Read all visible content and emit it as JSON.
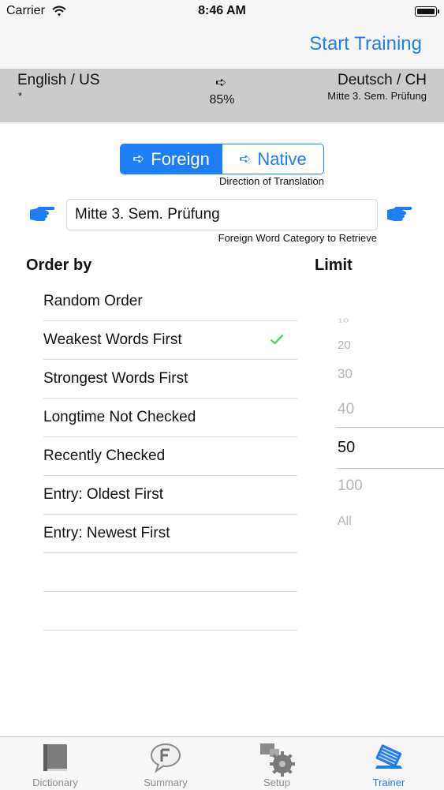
{
  "status_bar": {
    "carrier": "Carrier",
    "time": "8:46 AM"
  },
  "nav": {
    "start_training": "Start Training"
  },
  "language_bar": {
    "left_language": "English / US",
    "left_sub": "*",
    "arrow": "➪",
    "percent": "85%",
    "right_language": "Deutsch / CH",
    "right_sub": "Mitte 3. Sem. Prüfung"
  },
  "direction": {
    "arrow": "➪",
    "options": [
      "Foreign",
      "Native"
    ],
    "selected": "Foreign",
    "label": "Direction of Translation"
  },
  "category": {
    "value": "Mitte 3. Sem. Prüfung",
    "label": "Foreign Word Category to Retrieve"
  },
  "order_by": {
    "header": "Order by",
    "items": [
      {
        "label": "Random Order"
      },
      {
        "label": "Weakest Words First",
        "checked": true
      },
      {
        "label": "Strongest Words First"
      },
      {
        "label": "Longtime Not Checked"
      },
      {
        "label": "Recently Checked"
      },
      {
        "label": "Entry: Oldest First"
      },
      {
        "label": "Entry: Newest First"
      },
      {
        "label": ""
      },
      {
        "label": ""
      }
    ]
  },
  "limit": {
    "header": "Limit",
    "options": [
      "10",
      "20",
      "30",
      "40",
      "50",
      "100",
      "All"
    ],
    "selected": "50"
  },
  "tabbar": {
    "tabs": [
      {
        "label": "Dictionary",
        "icon": "dictionary-book-icon"
      },
      {
        "label": "Summary",
        "icon": "summary-speech-bubble-icon"
      },
      {
        "label": "Setup",
        "icon": "setup-gear-icon"
      },
      {
        "label": "Trainer",
        "icon": "trainer-cards-icon",
        "active": true
      }
    ]
  },
  "colors": {
    "accent": "#1f7df6",
    "check": "#4cd964",
    "lang_bar": "#cbcbcb"
  }
}
